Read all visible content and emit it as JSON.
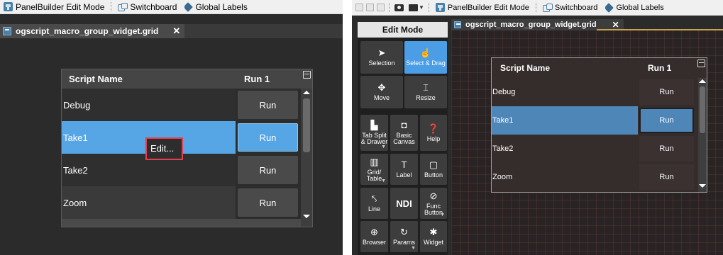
{
  "left": {
    "toolbar": {
      "panelbuilder_label": "PanelBuilder Edit Mode",
      "switchboard_label": "Switchboard",
      "global_labels_label": "Global Labels"
    },
    "tab": {
      "title": "ogscript_macro_group_widget.grid",
      "close": "✕"
    },
    "grid": {
      "header": {
        "col1": "Script Name",
        "col2": "Run 1"
      },
      "rows": [
        {
          "name": "Debug",
          "run": "Run",
          "selected": false
        },
        {
          "name": "Take1",
          "run": "Run",
          "selected": true
        },
        {
          "name": "Take2",
          "run": "Run",
          "selected": false
        },
        {
          "name": "Zoom",
          "run": "Run",
          "selected": false
        }
      ]
    },
    "context_popup": {
      "label": "Edit..."
    }
  },
  "right": {
    "toolbar": {
      "panelbuilder_label": "PanelBuilder Edit Mode",
      "switchboard_label": "Switchboard",
      "global_labels_label": "Global Labels"
    },
    "edit_mode": {
      "title": "Edit Mode",
      "tools": [
        {
          "id": "selection",
          "label": "Selection",
          "icon": "arrow-pointer-icon",
          "glyph": "➤"
        },
        {
          "id": "select-drag",
          "label": "Select & Drag",
          "icon": "hand-pointer-icon",
          "glyph": "☝"
        },
        {
          "id": "move",
          "label": "Move",
          "icon": "move-arrows-icon",
          "glyph": "✥"
        },
        {
          "id": "resize",
          "label": "Resize",
          "icon": "resize-icon",
          "glyph": "⌶"
        },
        {
          "id": "tab-split-drawer",
          "label": "Tab Split & Drawer",
          "icon": "tab-icon",
          "glyph": "▙"
        },
        {
          "id": "basic-canvas",
          "label": "Basic Canvas",
          "icon": "canvas-icon",
          "glyph": "◘"
        },
        {
          "id": "help",
          "label": "Help",
          "icon": "help-icon",
          "glyph": "❓"
        },
        {
          "id": "grid-table",
          "label": "Grid/ Table",
          "icon": "grid-table-icon",
          "glyph": "▥"
        },
        {
          "id": "label",
          "label": "Label",
          "icon": "label-t-icon",
          "glyph": "T"
        },
        {
          "id": "button",
          "label": "Button",
          "icon": "button-icon",
          "glyph": "▢"
        },
        {
          "id": "line",
          "label": "Line",
          "icon": "line-icon",
          "glyph": "⤣"
        },
        {
          "id": "ndi",
          "label": "NDI",
          "icon": "ndi-icon",
          "glyph": ""
        },
        {
          "id": "func-button",
          "label": "Func Button",
          "icon": "func-button-icon",
          "glyph": "⊘"
        },
        {
          "id": "browser",
          "label": "Browser",
          "icon": "globe-icon",
          "glyph": "⊕"
        },
        {
          "id": "params",
          "label": "Params",
          "icon": "params-icon",
          "glyph": "↻"
        },
        {
          "id": "widget",
          "label": "Widget",
          "icon": "widget-icon",
          "glyph": "✱"
        }
      ]
    },
    "tab": {
      "title": "ogscript_macro_group_widget.grid",
      "close": "✕"
    },
    "grid": {
      "header": {
        "col1": "Script Name",
        "col2": "Run 1"
      },
      "rows": [
        {
          "name": "Debug",
          "run": "Run",
          "selected": false
        },
        {
          "name": "Take1",
          "run": "Run",
          "selected": true
        },
        {
          "name": "Take2",
          "run": "Run",
          "selected": false
        },
        {
          "name": "Zoom",
          "run": "Run",
          "selected": false
        }
      ]
    }
  },
  "colors": {
    "selected_row": "#56a6e6",
    "selected_button": "#4b9ee6",
    "accent_highlight": "#e04050"
  }
}
